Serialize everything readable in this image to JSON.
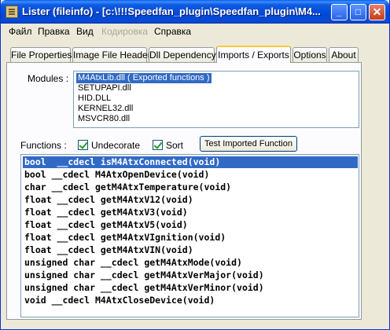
{
  "window": {
    "title": "Lister (fileinfo) - [c:\\!!!Speedfan_plugin\\Speedfan_plugin\\M4..."
  },
  "titlebar_buttons": {
    "minimize": "_",
    "maximize": "□",
    "close": "✕"
  },
  "menu": [
    {
      "label": "Файл",
      "enabled": true
    },
    {
      "label": "Правка",
      "enabled": true
    },
    {
      "label": "Вид",
      "enabled": true
    },
    {
      "label": "Кодировка",
      "enabled": false
    },
    {
      "label": "Справка",
      "enabled": true
    }
  ],
  "tabs": [
    "File Properties",
    "Image File Header",
    "Dll Dependency",
    "Imports / Exports",
    "Options",
    "About"
  ],
  "active_tab": "Imports / Exports",
  "modules": {
    "label": "Modules :",
    "items": [
      "M4AtxLib.dll ( Exported functions )",
      "SETUPAPI.dll",
      "HID.DLL",
      "KERNEL32.dll",
      "MSVCR80.dll"
    ],
    "selected_index": 0
  },
  "functions": {
    "label": "Functions :",
    "undecorate": {
      "label": "Undecorate",
      "checked": true
    },
    "sort": {
      "label": "Sort",
      "checked": true
    },
    "test_button": "Test Imported Function",
    "items": [
      "bool  __cdecl isM4AtxConnected(void)",
      "bool __cdecl M4AtxOpenDevice(void)",
      "char __cdecl getM4AtxTemperature(void)",
      "float __cdecl getM4AtxV12(void)",
      "float __cdecl getM4AtxV3(void)",
      "float __cdecl getM4AtxV5(void)",
      "float __cdecl getM4AtxVIgnition(void)",
      "float __cdecl getM4AtxVIN(void)",
      "unsigned char __cdecl getM4AtxMode(void)",
      "unsigned char __cdecl getM4AtxVerMajor(void)",
      "unsigned char __cdecl getM4AtxVerMinor(void)",
      "void __cdecl M4AtxCloseDevice(void)"
    ],
    "selected_index": 0
  },
  "colors": {
    "selection": "#316ac5",
    "titlebar": "#0047d6",
    "face": "#ece9d8"
  }
}
